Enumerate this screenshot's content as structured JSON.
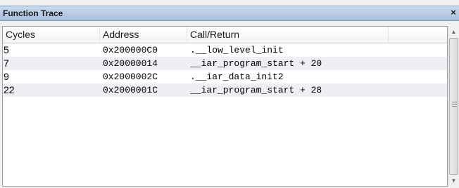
{
  "window": {
    "title": "Function Trace",
    "close_symbol": "×"
  },
  "columns": [
    "Cycles",
    "Address",
    "Call/Return",
    ""
  ],
  "rows": [
    {
      "cycles": "5",
      "address": "0x200000C0",
      "call": ".__low_level_init"
    },
    {
      "cycles": "7",
      "address": "0x20000014",
      "call": "__iar_program_start + 20"
    },
    {
      "cycles": "9",
      "address": "0x2000002C",
      "call": ".__iar_data_init2"
    },
    {
      "cycles": "22",
      "address": "0x2000001C",
      "call": "__iar_program_start + 28"
    }
  ],
  "icons": {
    "close": "close-icon",
    "scroll_up": "scroll-up-arrow-icon",
    "scroll_down": "scroll-down-arrow-icon"
  },
  "colors": {
    "titlebar": "#b4c8e4",
    "row_alt": "#eeeef5"
  }
}
